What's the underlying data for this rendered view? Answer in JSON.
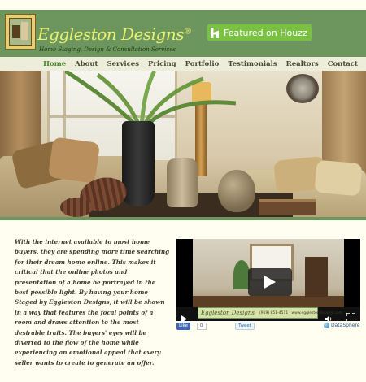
{
  "header": {
    "logo_title": "Eggleston Designs",
    "logo_mark": "®",
    "tagline": "Home Staging, Design & Consultation Services",
    "houzz_label": "Featured on Houzz",
    "houzz_icon": "houzz-icon"
  },
  "nav": {
    "items": [
      "Home",
      "About",
      "Services",
      "Pricing",
      "Portfolio",
      "Testimonials",
      "Realtors",
      "Contact"
    ],
    "active_index": 0
  },
  "hero": {
    "image": "staged-living-room-photo"
  },
  "content": {
    "blurb": "With the internet available to most home buyers, they are spending more time searching for their dream home online. This makes it critical that the online photos and presentation of a home be portrayed in the best possible light. By having your home Staged by Eggleston Designs, it will be shown in a way that features the focal points of a room and draws attention to the most desirable traits. The buyers' eyes will be diverted to the flow of the home while experiencing an emotional appeal that every seller wants to create to generate an offer."
  },
  "video": {
    "logo_text": "Eggleston Designs",
    "info_text": "(919) 851-4511 · www.egglestondesigns.com",
    "play_icon": "play-icon",
    "fullscreen_icon": "fullscreen-icon",
    "volume_icon": "volume-icon"
  },
  "share": {
    "like_label": "Like",
    "like_count": "0",
    "tweet_label": "Tweet",
    "provider": "DataSphere"
  },
  "colors": {
    "header_green": "#6d955e",
    "houzz_green": "#7ac143",
    "logo_yellow": "#e9f06b",
    "nav_active": "#4a8a2a",
    "page_bg": "#fffef0"
  }
}
